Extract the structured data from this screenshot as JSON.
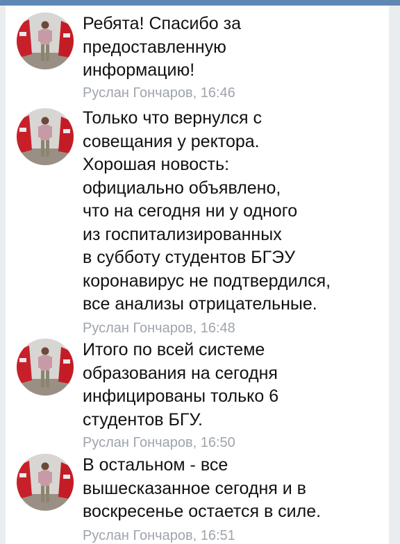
{
  "messages": [
    {
      "lines": [
        "Ребята! Спасибо за",
        "предоставленную",
        "информацию!"
      ],
      "author": "Руслан Гончаров",
      "time": "16:46"
    },
    {
      "lines": [
        "Только что вернулся с",
        "совещания у ректора.",
        "Хорошая новость:",
        "официально объявлено,",
        "что на сегодня ни у одного",
        "из госпитализированных",
        "в субботу студентов БГЭУ",
        "коронавирус не подтвердился,",
        "все анализы отрицательные."
      ],
      "author": "Руслан Гончаров",
      "time": "16:48"
    },
    {
      "lines": [
        "Итого по всей системе",
        "образования на сегодня",
        "инфицированы только 6",
        "студентов БГУ."
      ],
      "author": "Руслан Гончаров",
      "time": "16:50"
    },
    {
      "lines": [
        "В остальном - все",
        "вышесказанное сегодня и в",
        "воскресенье остается в силе."
      ],
      "author": "Руслан Гончаров",
      "time": "16:51"
    }
  ],
  "meta_separator": ", ",
  "colors": {
    "accent_strip": "#5e87b3",
    "text": "#111111",
    "meta": "#9ea4ab",
    "background": "#ffffff"
  },
  "icons": {
    "avatar": "user-photo-avatar-icon"
  }
}
